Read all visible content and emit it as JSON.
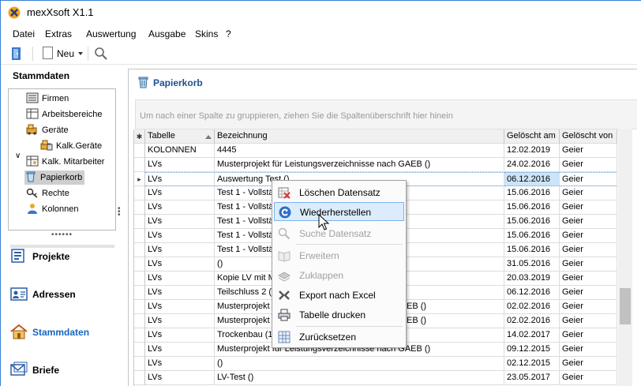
{
  "window": {
    "title": "mexXsoft X1.1"
  },
  "menu": [
    "Datei",
    "Extras",
    "Auswertung",
    "Ausgabe",
    "Skins",
    "?"
  ],
  "toolbar": {
    "new_label": "Neu"
  },
  "nav": {
    "title": "Stammdaten",
    "tree": [
      {
        "label": "Firmen",
        "icon": "firmen-icon"
      },
      {
        "label": "Arbeitsbereiche",
        "icon": "arbeitsbereiche-icon"
      },
      {
        "label": "Geräte",
        "icon": "geraete-icon"
      },
      {
        "label": "Kalk.Geräte",
        "icon": "kalk-geraete-icon"
      },
      {
        "label": "Kalk. Mitarbeiter",
        "icon": "mitarbeiter-icon"
      },
      {
        "label": "Papierkorb",
        "icon": "trash-icon"
      },
      {
        "label": "Rechte",
        "icon": "rechte-icon"
      },
      {
        "label": "Kolonnen",
        "icon": "kolonnen-icon"
      }
    ],
    "buttons": [
      {
        "label": "Projekte",
        "icon": "projekte-icon"
      },
      {
        "label": "Adressen",
        "icon": "adressen-icon"
      },
      {
        "label": "Stammdaten",
        "icon": "stammdaten-icon"
      },
      {
        "label": "Briefe",
        "icon": "briefe-icon"
      }
    ]
  },
  "main": {
    "title": "Papierkorb",
    "group_hint": "Um nach einer Spalte zu gruppieren, ziehen Sie die Spaltenüberschrift hier hinein",
    "columns": [
      "Tabelle",
      "Bezeichnung",
      "Gelöscht am",
      "Gelöscht von"
    ],
    "rows": [
      [
        "KOLONNEN",
        "4445",
        "12.02.2019",
        "Geier"
      ],
      [
        "LVs",
        "Musterprojekt für Leistungsverzeichnisse nach GAEB ()",
        "24.02.2016",
        "Geier"
      ],
      [
        "LVs",
        "Auswertung Test ()",
        "06.12.2016",
        "Geier"
      ],
      [
        "LVs",
        "Test 1 - Vollstä",
        "15.06.2016",
        "Geier"
      ],
      [
        "LVs",
        "Test 1 - Vollstä",
        "15.06.2016",
        "Geier"
      ],
      [
        "LVs",
        "Test 1 - Vollstä",
        "15.06.2016",
        "Geier"
      ],
      [
        "LVs",
        "Test 1 - Vollstä",
        "15.06.2016",
        "Geier"
      ],
      [
        "LVs",
        "Test 1 - Vollstä",
        "15.06.2016",
        "Geier"
      ],
      [
        "LVs",
        " ()",
        "31.05.2016",
        "Geier"
      ],
      [
        "LVs",
        "Kopie LV mit Ma",
        "20.03.2019",
        "Geier"
      ],
      [
        "LVs",
        "Teilschluss 2 ()",
        "06.12.2016",
        "Geier"
      ],
      [
        "LVs",
        "Musterprojekt",
        "02.02.2016",
        "Geier"
      ],
      [
        "LVs",
        "Musterprojekt",
        "02.02.2016",
        "Geier"
      ],
      [
        "LVs",
        "Trockenbau (1",
        "14.02.2017",
        "Geier"
      ],
      [
        "LVs",
        "Musterprojekt für Leistungsverzeichnisse nach GAEB ()",
        "09.12.2015",
        "Geier"
      ],
      [
        "LVs",
        " ()",
        "02.12.2015",
        "Geier"
      ],
      [
        "LVs",
        "LV-Test ()",
        "23.05.2017",
        "Geier"
      ]
    ],
    "row_suffix_visible": [
      "",
      "",
      "",
      "",
      "",
      "",
      "",
      "",
      "",
      "",
      "",
      "EB ()",
      "EB ()",
      "",
      "",
      "",
      ""
    ]
  },
  "context_menu": [
    {
      "label": "Löschen Datensatz",
      "icon": "delete-record-icon",
      "disabled": false
    },
    {
      "label": "Wiederherstellen",
      "icon": "restore-icon",
      "disabled": false,
      "highlighted": true
    },
    {
      "label": "Suche Datensatz",
      "icon": "search-icon",
      "disabled": true
    },
    {
      "label": "Erweitern",
      "icon": "expand-icon",
      "disabled": true
    },
    {
      "label": "Zuklappen",
      "icon": "collapse-icon",
      "disabled": true
    },
    {
      "label": "Export nach Excel",
      "icon": "excel-icon",
      "disabled": false
    },
    {
      "label": "Tabelle drucken",
      "icon": "print-icon",
      "disabled": false
    },
    {
      "label": "Zurücksetzen",
      "icon": "reset-icon",
      "disabled": false
    }
  ]
}
